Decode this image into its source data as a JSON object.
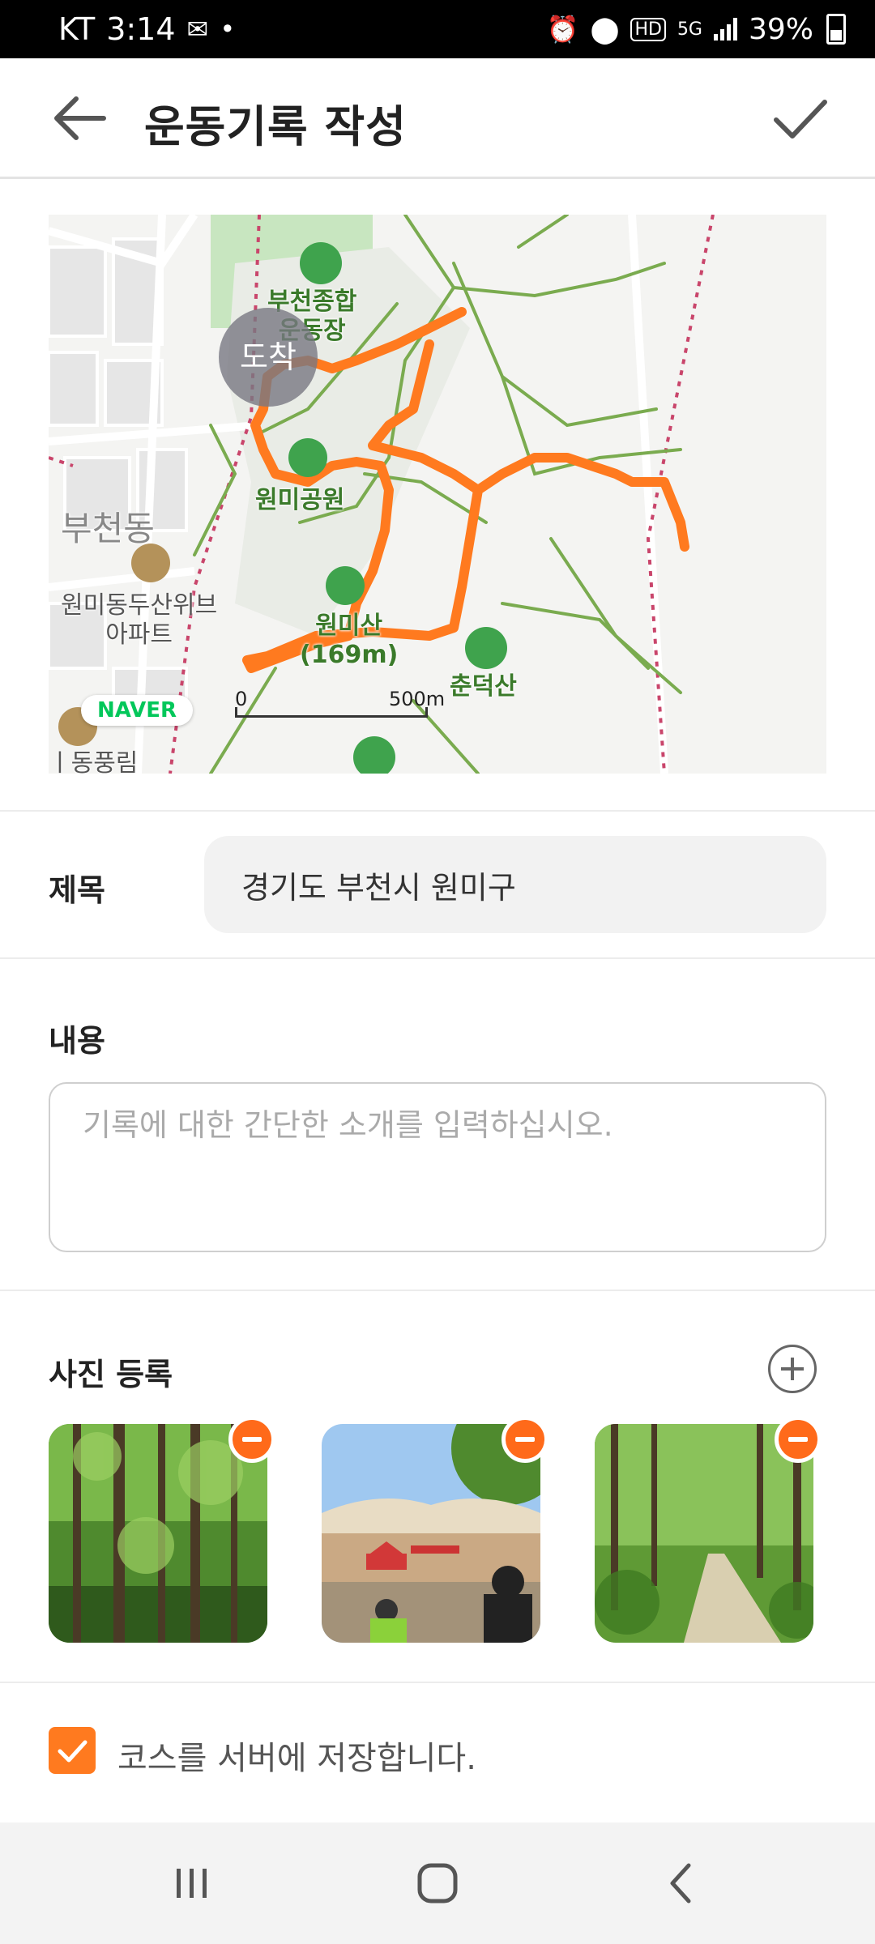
{
  "status_bar": {
    "carrier": "KT",
    "time": "3:14",
    "network": "5G",
    "hd": "HD",
    "battery": "39%"
  },
  "header": {
    "title": "운동기록 작성",
    "icons": {
      "back": "arrow-left-icon",
      "confirm": "check-icon"
    }
  },
  "map": {
    "pin_label": "도착",
    "brand": "NAVER",
    "scale_start": "0",
    "scale_end": "500m",
    "labels": {
      "stadium_line1": "부천종합",
      "stadium_line2": "운동장",
      "park": "원미공원",
      "district": "부천동",
      "apt_line1": "원미동두산위브",
      "apt_line2": "아파트",
      "mountain_line1": "원미산",
      "mountain_line2": "(169m)",
      "chundeok": "춘덕산",
      "bottom_left": "ㅣ동풍림"
    },
    "colors": {
      "route": "#ff7a1f",
      "trail": "#7aab4f",
      "rail": "#c9456b"
    }
  },
  "form": {
    "title_label": "제목",
    "title_value": "경기도 부천시 원미구",
    "content_label": "내용",
    "content_placeholder": "기록에 대한 간단한 소개를 입력하십시오.",
    "photo_label": "사진 등록",
    "photos": [
      "forest",
      "amphitheater",
      "forest-path"
    ],
    "save_course_label": "코스를 서버에 저장합니다.",
    "save_course_checked": true
  },
  "theme": {
    "accent": "#ff7a1f"
  }
}
